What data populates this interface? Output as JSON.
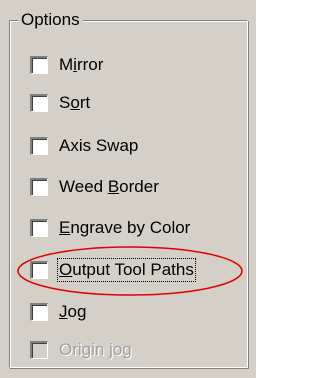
{
  "group": {
    "title": "Options"
  },
  "checkboxes": [
    {
      "pre": "M",
      "u": "i",
      "post": "rror",
      "checked": false,
      "disabled": false
    },
    {
      "pre": "S",
      "u": "o",
      "post": "rt",
      "checked": false,
      "disabled": false
    },
    {
      "pre": "Axis Swap",
      "u": "",
      "post": "",
      "checked": false,
      "disabled": false
    },
    {
      "pre": "Weed ",
      "u": "B",
      "post": "order",
      "checked": false,
      "disabled": false
    },
    {
      "pre": "",
      "u": "E",
      "post": "ngrave by Color",
      "checked": false,
      "disabled": false
    },
    {
      "pre": "",
      "u": "O",
      "post": "utput Tool Paths",
      "checked": false,
      "disabled": false
    },
    {
      "pre": "",
      "u": "J",
      "post": "og",
      "checked": false,
      "disabled": false
    },
    {
      "pre": "Origin jog",
      "u": "",
      "post": "",
      "checked": false,
      "disabled": true
    }
  ],
  "annotation": {
    "color": "#e00000"
  }
}
